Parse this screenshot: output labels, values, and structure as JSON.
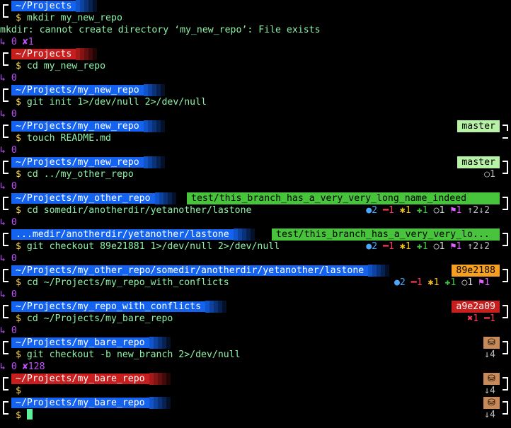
{
  "colors": {
    "path_blue": "#1463f0",
    "path_red": "#c81e1e",
    "branch_green": "#47c43b",
    "branch_lightgreen": "#b7f2a6",
    "hash_orange": "#f5a020",
    "hash_red": "#c81e1e",
    "bare_tan": "#c88a58",
    "exit_purple": "#c050ff"
  },
  "blocks": [
    {
      "path": "~/Projects",
      "cmd": "mkdir my_new_repo"
    },
    {
      "output": "mkdir: cannot create directory ‘my_new_repo’: File exists"
    },
    {
      "exit": "↳ 0 ✘1"
    },
    {
      "path": "~/Projects",
      "cmd": "cd my_new_repo"
    },
    {
      "exit": "↳ 0"
    },
    {
      "path": "~/Projects/my_new_repo",
      "cmd": "git init 1>/dev/null 2>/dev/null"
    },
    {
      "exit": "↳ 0"
    },
    {
      "path": "~/Projects/my_new_repo",
      "branch": "master",
      "cmd": "touch README.md"
    },
    {
      "exit": "↳ 0"
    },
    {
      "path": "~/Projects/my_new_repo",
      "branch": "master",
      "cmd": "cd ../my_other_repo",
      "status": "○1"
    },
    {
      "exit": "↳ 0"
    },
    {
      "path": "~/Projects/my_other_repo",
      "branch": "test/this_branch_has_a_very_very_long_name_indeed",
      "cmd": "cd somedir/anotherdir/yetanother/lastone"
    },
    {
      "exit": "↳ 0"
    },
    {
      "path": "...medir/anotherdir/yetanother/lastone",
      "branch": "test/this_branch_has_a_very_very_lo...",
      "cmd": "git checkout 89e21881 1>/dev/null 2>/dev/null"
    },
    {
      "exit": "↳ 0"
    },
    {
      "path": "~/Projects/my_other_repo/somedir/anotherdir/yetanother/lastone",
      "branch": "89e2188",
      "cmd": "cd ~/Projects/my_repo_with_conflicts"
    },
    {
      "exit": "↳ 0"
    },
    {
      "path": "~/Projects/my_repo_with_conflicts",
      "branch": "a9e2a09",
      "cmd": "cd ~/Projects/my_bare_repo",
      "status": "✖1 ━1"
    },
    {
      "exit": "↳ 0"
    },
    {
      "path": "~/Projects/my_bare_repo",
      "branch": "⛁",
      "cmd": "git checkout -b new_branch 2>/dev/null",
      "status": "↓4"
    },
    {
      "exit": "↳ 0 ✘128"
    },
    {
      "path": "~/Projects/my_bare_repo",
      "branch": "⛁",
      "cmd": "",
      "status": "↓4"
    },
    {
      "path": "~/Projects/my_bare_repo",
      "branch": "⛁",
      "cmd": "",
      "status": "↓4"
    }
  ],
  "stat_sets": {
    "other_repo": [
      "●2",
      "━1",
      "✱1",
      "✚1",
      "○1",
      "⚑1",
      "↑2↓2"
    ],
    "lastone": [
      "●2",
      "━1",
      "✱1",
      "✚1",
      "○1",
      "⚑1"
    ]
  },
  "prompt_symbol": "$"
}
